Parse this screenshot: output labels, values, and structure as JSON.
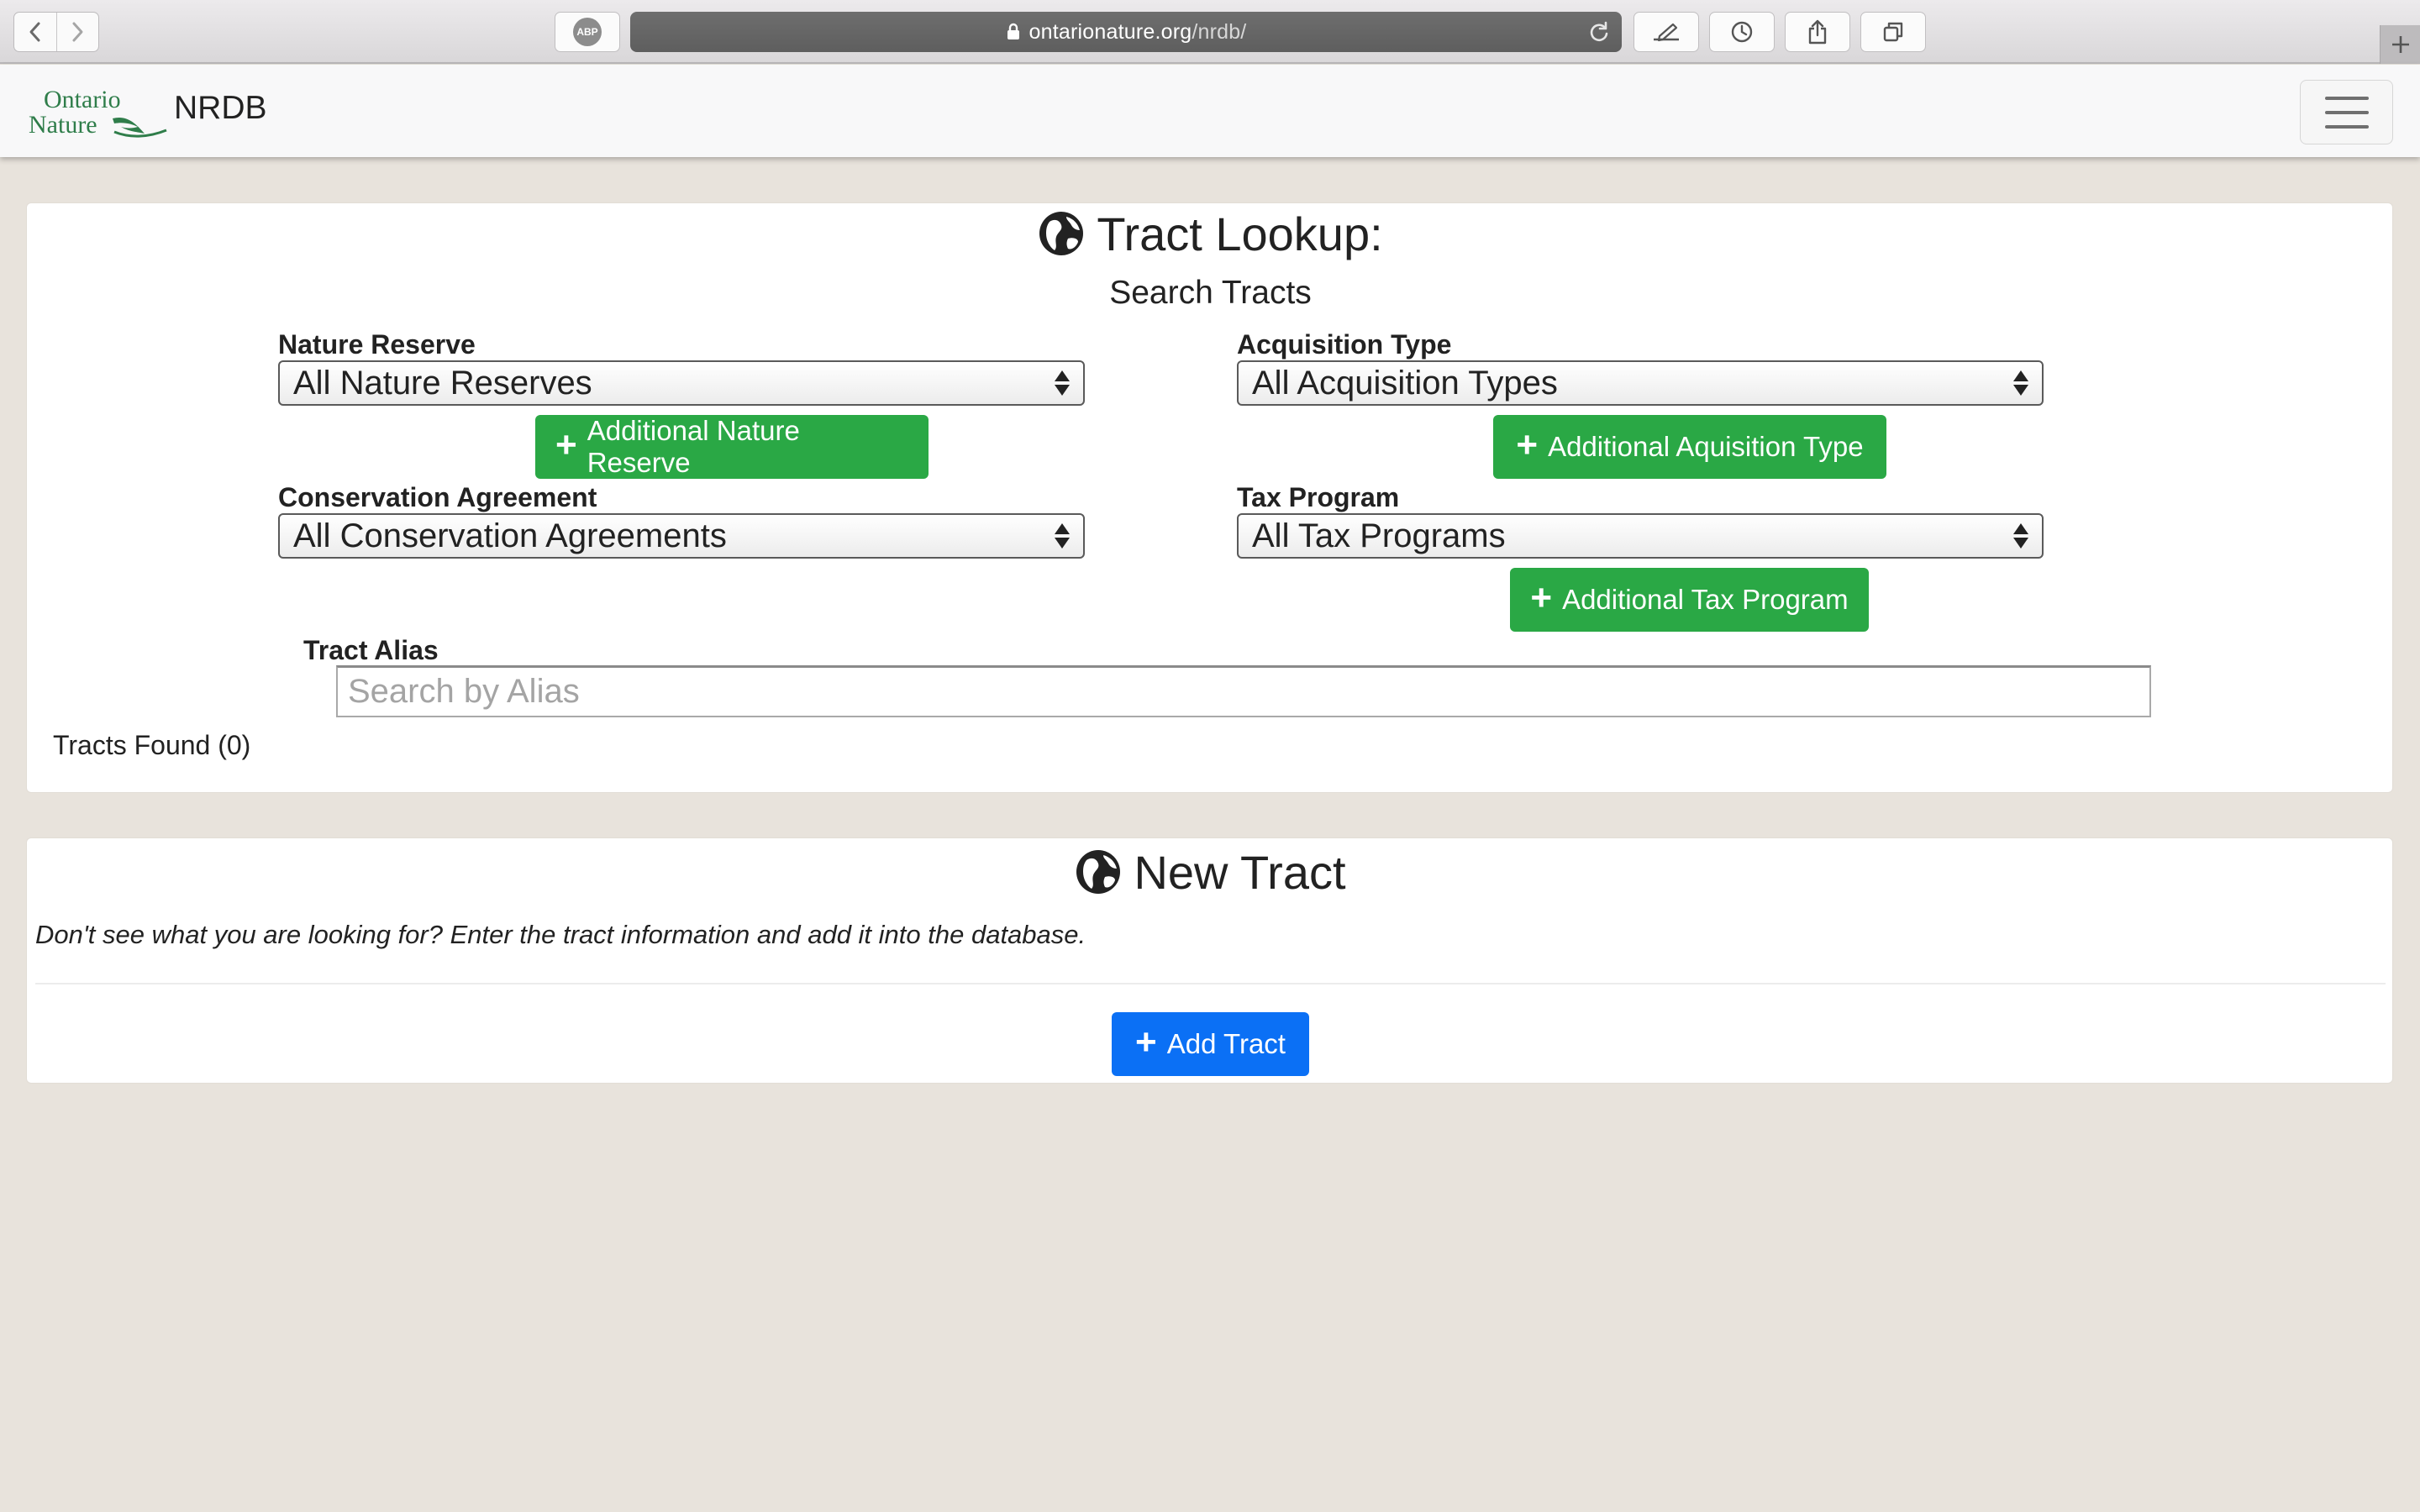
{
  "browser": {
    "url_domain": "ontarionature.org",
    "url_path": "/nrdb/",
    "adblock_label": "ABP"
  },
  "navbar": {
    "logo_line1": "Ontario",
    "logo_line2": "Nature",
    "brand": "NRDB"
  },
  "lookup": {
    "title": "Tract Lookup:",
    "subtitle": "Search Tracts",
    "nature_reserve_label": "Nature Reserve",
    "nature_reserve_value": "All Nature Reserves",
    "add_nature_reserve": "Additional Nature Reserve",
    "acquisition_type_label": "Acquisition Type",
    "acquisition_type_value": "All Acquisition Types",
    "add_acquisition_type": "Additional Aquisition Type",
    "conservation_agreement_label": "Conservation Agreement",
    "conservation_agreement_value": "All Conservation Agreements",
    "tax_program_label": "Tax Program",
    "tax_program_value": "All Tax Programs",
    "add_tax_program": "Additional Tax Program",
    "alias_label": "Tract Alias",
    "alias_placeholder": "Search by Alias",
    "alias_value": "",
    "tracts_found": "Tracts Found (0)"
  },
  "new_tract": {
    "title": "New Tract",
    "description": "Don't see what you are looking for? Enter the tract information and add it into the database.",
    "add_button": "Add Tract"
  },
  "colors": {
    "page_bg": "#e8e3dc",
    "success_green": "#2aa845",
    "primary_blue": "#0b70f5",
    "logo_green": "#2f7d4a"
  }
}
